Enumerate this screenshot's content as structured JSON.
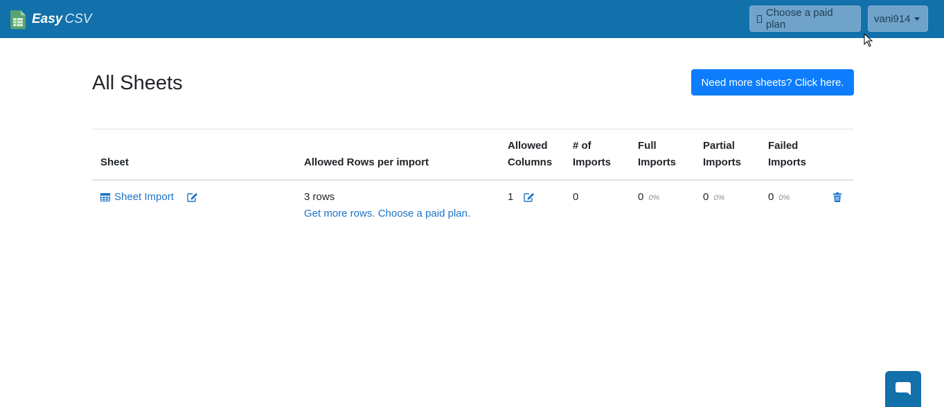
{
  "navbar": {
    "brand_bold": "Easy",
    "brand_light": "CSV",
    "paid_plan_label": "Choose a paid plan",
    "username": "vani914"
  },
  "page": {
    "title": "All Sheets",
    "need_more_label": "Need more sheets? Click here."
  },
  "table": {
    "headers": {
      "sheet": "Sheet",
      "allowed_rows": "Allowed Rows per import",
      "allowed_columns_1": "Allowed",
      "allowed_columns_2": "Columns",
      "imports_1": "# of",
      "imports_2": "Imports",
      "full_1": "Full",
      "full_2": "Imports",
      "partial_1": "Partial",
      "partial_2": "Imports",
      "failed_1": "Failed",
      "failed_2": "Imports"
    },
    "rows": [
      {
        "sheet_name": "Sheet Import",
        "allowed_rows": "3 rows",
        "upgrade_link": "Get more rows. Choose a paid plan.",
        "allowed_columns": "1",
        "num_imports": "0",
        "full_imports": "0",
        "full_pct": "0%",
        "partial_imports": "0",
        "partial_pct": "0%",
        "failed_imports": "0",
        "failed_pct": "0%"
      }
    ]
  },
  "icons": {
    "brand": "spreadsheet-icon",
    "sheet": "table-icon",
    "edit": "edit-icon",
    "delete": "trash-icon",
    "chat": "chat-icon"
  },
  "colors": {
    "navbar": "#1270aa",
    "primary_button": "#0d7dfd",
    "link": "#1a73c9"
  }
}
